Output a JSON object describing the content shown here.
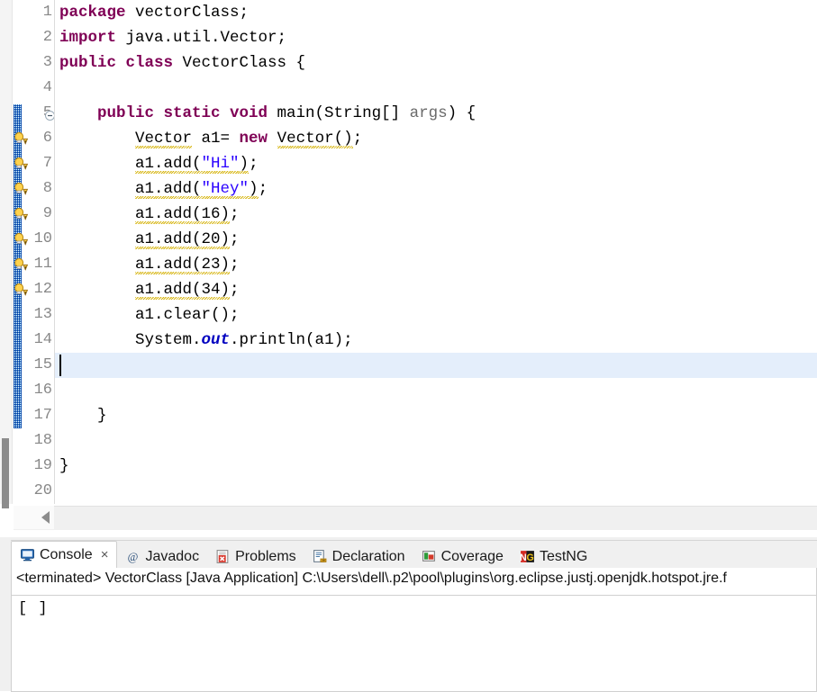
{
  "editor": {
    "name": "java-code-editor",
    "first_line": 1,
    "total_visible_lines": 20,
    "current_line": 15,
    "fold_marker_line": 5,
    "warning_lines": [
      6,
      7,
      8,
      9,
      10,
      11,
      12
    ],
    "change_bar_range": [
      5,
      17
    ],
    "line_numbers": [
      "1",
      "2",
      "3",
      "4",
      "5",
      "6",
      "7",
      "8",
      "9",
      "10",
      "11",
      "12",
      "13",
      "14",
      "15",
      "16",
      "17",
      "18",
      "19",
      "20"
    ],
    "lines": [
      {
        "n": "1",
        "tokens": [
          {
            "t": "package",
            "c": "kw"
          },
          {
            "t": " vectorClass;",
            "c": "plain"
          }
        ]
      },
      {
        "n": "2",
        "tokens": [
          {
            "t": "import",
            "c": "kw"
          },
          {
            "t": " java.util.Vector;",
            "c": "plain"
          }
        ]
      },
      {
        "n": "3",
        "tokens": [
          {
            "t": "public class",
            "c": "kw"
          },
          {
            "t": " VectorClass {",
            "c": "plain"
          }
        ]
      },
      {
        "n": "4",
        "tokens": []
      },
      {
        "n": "5",
        "tokens": [
          {
            "t": "    ",
            "c": "plain"
          },
          {
            "t": "public static void",
            "c": "kw"
          },
          {
            "t": " main(String[] ",
            "c": "plain"
          },
          {
            "t": "args",
            "c": "param"
          },
          {
            "t": ") {",
            "c": "plain"
          }
        ]
      },
      {
        "n": "6",
        "tokens": [
          {
            "t": "        ",
            "c": "plain"
          },
          {
            "t": "Vector",
            "c": "plain",
            "squiggle": true
          },
          {
            "t": " a1= ",
            "c": "plain"
          },
          {
            "t": "new",
            "c": "kw"
          },
          {
            "t": " ",
            "c": "plain"
          },
          {
            "t": "Vector()",
            "c": "plain",
            "squiggle": true
          },
          {
            "t": ";",
            "c": "plain"
          }
        ]
      },
      {
        "n": "7",
        "tokens": [
          {
            "t": "        ",
            "c": "plain"
          },
          {
            "t": "a1.add(",
            "c": "plain",
            "squiggle": true
          },
          {
            "t": "\"Hi\"",
            "c": "str",
            "squiggle": true
          },
          {
            "t": ")",
            "c": "plain",
            "squiggle": true
          },
          {
            "t": ";",
            "c": "plain"
          }
        ]
      },
      {
        "n": "8",
        "tokens": [
          {
            "t": "        ",
            "c": "plain"
          },
          {
            "t": "a1.add(",
            "c": "plain",
            "squiggle": true
          },
          {
            "t": "\"Hey\"",
            "c": "str",
            "squiggle": true
          },
          {
            "t": ")",
            "c": "plain",
            "squiggle": true
          },
          {
            "t": ";",
            "c": "plain"
          }
        ]
      },
      {
        "n": "9",
        "tokens": [
          {
            "t": "        ",
            "c": "plain"
          },
          {
            "t": "a1.add(16)",
            "c": "plain",
            "squiggle": true
          },
          {
            "t": ";",
            "c": "plain"
          }
        ]
      },
      {
        "n": "10",
        "tokens": [
          {
            "t": "        ",
            "c": "plain"
          },
          {
            "t": "a1.add(20)",
            "c": "plain",
            "squiggle": true
          },
          {
            "t": ";",
            "c": "plain"
          }
        ]
      },
      {
        "n": "11",
        "tokens": [
          {
            "t": "        ",
            "c": "plain"
          },
          {
            "t": "a1.add(23)",
            "c": "plain",
            "squiggle": true
          },
          {
            "t": ";",
            "c": "plain"
          }
        ]
      },
      {
        "n": "12",
        "tokens": [
          {
            "t": "        ",
            "c": "plain"
          },
          {
            "t": "a1.add(34)",
            "c": "plain",
            "squiggle": true
          },
          {
            "t": ";",
            "c": "plain"
          }
        ]
      },
      {
        "n": "13",
        "tokens": [
          {
            "t": "        a1.clear();",
            "c": "plain"
          }
        ]
      },
      {
        "n": "14",
        "tokens": [
          {
            "t": "        System.",
            "c": "plain"
          },
          {
            "t": "out",
            "c": "fld"
          },
          {
            "t": ".println(a1);",
            "c": "plain"
          }
        ]
      },
      {
        "n": "15",
        "tokens": []
      },
      {
        "n": "16",
        "tokens": []
      },
      {
        "n": "17",
        "tokens": [
          {
            "t": "    }",
            "c": "plain"
          }
        ]
      },
      {
        "n": "18",
        "tokens": []
      },
      {
        "n": "19",
        "tokens": [
          {
            "t": "}",
            "c": "plain"
          }
        ]
      },
      {
        "n": "20",
        "tokens": []
      }
    ],
    "source_text": "package vectorClass;\nimport java.util.Vector;\npublic class VectorClass {\n\n    public static void main(String[] args) {\n        Vector a1= new Vector();\n        a1.add(\"Hi\");\n        a1.add(\"Hey\");\n        a1.add(16);\n        a1.add(20);\n        a1.add(23);\n        a1.add(34);\n        a1.clear();\n        System.out.println(a1);\n\n\n    }\n\n}\n"
  },
  "console_panel": {
    "tabs": [
      {
        "label": "Console",
        "icon": "console-icon",
        "active": true,
        "closable": true
      },
      {
        "label": "Javadoc",
        "icon": "javadoc-at-icon",
        "active": false,
        "closable": false
      },
      {
        "label": "Problems",
        "icon": "problems-icon",
        "active": false,
        "closable": false
      },
      {
        "label": "Declaration",
        "icon": "declaration-icon",
        "active": false,
        "closable": false
      },
      {
        "label": "Coverage",
        "icon": "coverage-icon",
        "active": false,
        "closable": false
      },
      {
        "label": "TestNG",
        "icon": "testng-icon",
        "active": false,
        "closable": false
      }
    ],
    "close_glyph": "×",
    "process_line": "<terminated> VectorClass [Java Application] C:\\Users\\dell\\.p2\\pool\\plugins\\org.eclipse.justj.openjdk.hotspot.jre.f",
    "output": "[ ]"
  },
  "colors": {
    "keyword": "#7f0055",
    "string": "#2a00ff",
    "static_field": "#0000c0",
    "parameter": "#6a6a6a",
    "plain_code": "#000000",
    "line_number": "#888888",
    "current_line_highlight": "#e4eefb",
    "change_bar": "#1a6fc4",
    "warning_squiggle": "#d4b000",
    "panel_bg": "#f0f0f0",
    "editor_bg": "#ffffff"
  },
  "scrollbars": {
    "vertical_present": true,
    "horizontal_present": true,
    "h_left_arrow": "left-arrow"
  }
}
